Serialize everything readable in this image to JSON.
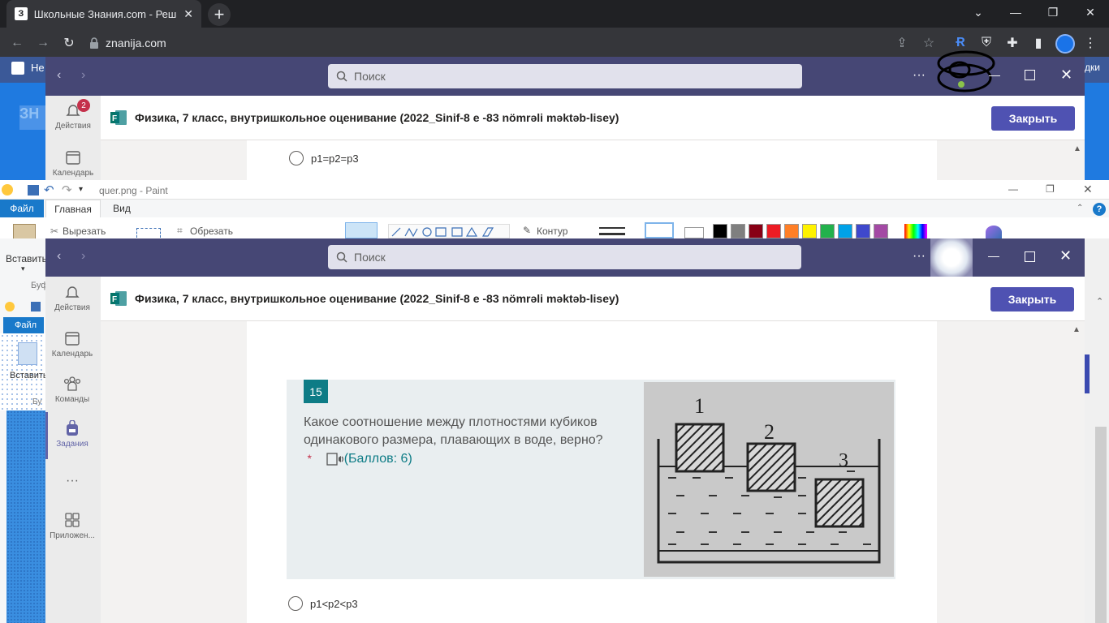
{
  "browser": {
    "tab_title": "Школьные Знания.com - Решае",
    "favicon_letter": "З",
    "tab_close": "✕",
    "new_tab": "+",
    "url": "znanija.com"
  },
  "bookmarks": {
    "left_fragment": "Не",
    "right_fragment": "дки"
  },
  "teams_top": {
    "search_placeholder": "Поиск",
    "more": "···",
    "form_title": "Физика, 7 класс, внутришкольное оценивание (2022_Sinif-8 e -83 nömrəli məktəb-lisey)",
    "close_button": "Закрыть",
    "rail": [
      {
        "label": "Действия",
        "badge": "2"
      },
      {
        "label": "Календарь"
      }
    ],
    "option_visible": "p1=p2=p3"
  },
  "paint": {
    "title": "quer.png - Paint",
    "tabs": [
      "Файл",
      "Главная",
      "Вид"
    ],
    "cut": "Вырезать",
    "crop": "Обрезать",
    "outline": "Контур",
    "paste": "Вставить",
    "buffer": "Буф",
    "help": "?",
    "colors": [
      "#000000",
      "#7f7f7f",
      "#880015",
      "#ed1c24",
      "#ff7f27",
      "#fff200",
      "#22b14c",
      "#00a2e8",
      "#3f48cc",
      "#a349a4"
    ]
  },
  "inner_paint": {
    "file": "Файл",
    "paste": "Вставить",
    "buffer": "Бу"
  },
  "teams_main": {
    "search_placeholder": "Поиск",
    "more": "···",
    "form_title": "Физика, 7 класс, внутришкольное оценивание (2022_Sinif-8 e -83 nömrəli məktəb-lisey)",
    "close_button": "Закрыть",
    "rail": [
      {
        "label": "Действия"
      },
      {
        "label": "Календарь"
      },
      {
        "label": "Команды"
      },
      {
        "label": "Задания"
      },
      {
        "label": "···"
      },
      {
        "label": "Приложен..."
      }
    ]
  },
  "question": {
    "number": "15",
    "text": "Какое соотношение между плотностями кубиков одинакового размера, плавающих в воде, верно?",
    "required_mark": "*",
    "points": "(Баллов: 6)",
    "image_labels": [
      "1",
      "2",
      "3"
    ],
    "option_below": "p1<p2<p3"
  }
}
